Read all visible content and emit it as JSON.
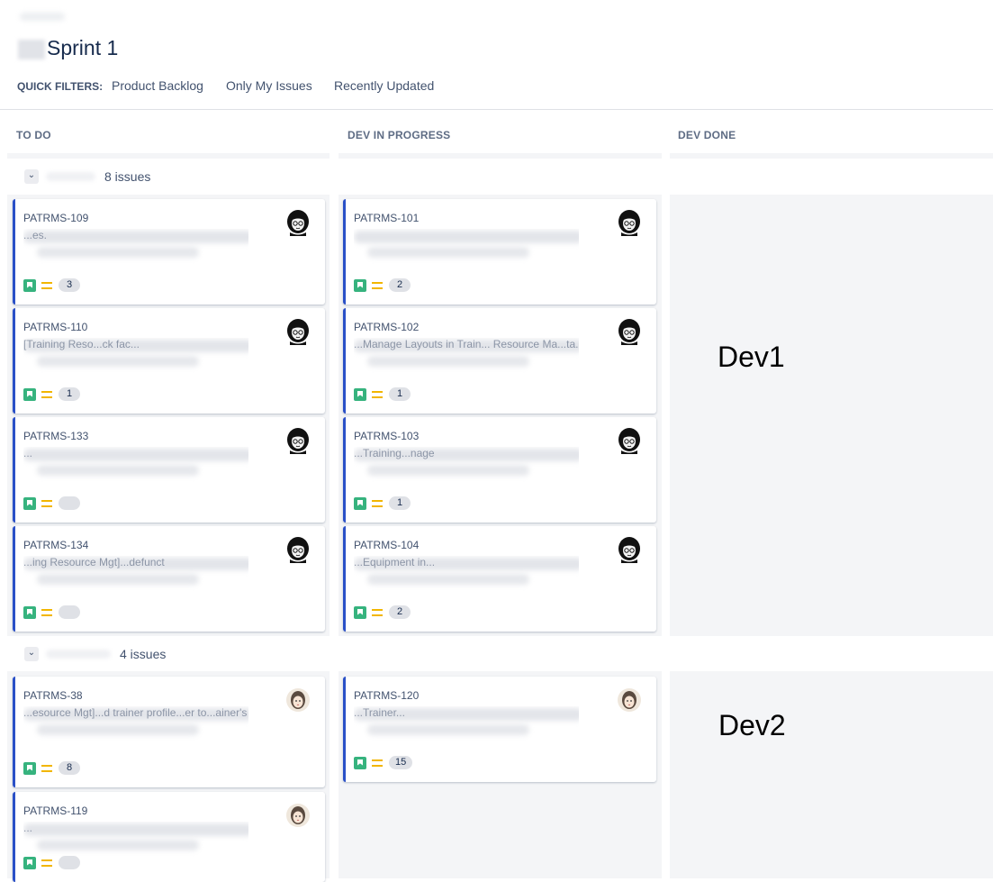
{
  "board": {
    "title": "Sprint 1"
  },
  "quick_filters": {
    "label": "QUICK FILTERS:",
    "items": [
      "Product Backlog",
      "Only My Issues",
      "Recently Updated"
    ]
  },
  "columns": [
    "TO DO",
    "DEV IN PROGRESS",
    "DEV DONE"
  ],
  "swimlanes": [
    {
      "count": "8 issues",
      "annotation": "Dev1"
    },
    {
      "count": "4 issues",
      "annotation": "Dev2"
    }
  ],
  "cards": [
    {
      "key": "PATRMS-109",
      "summary": "...es.",
      "estimate": "3",
      "avatar": "dark-avatar-icon"
    },
    {
      "key": "PATRMS-110",
      "summary": "[Training Reso...ck fac...",
      "estimate": "1",
      "avatar": "dark-avatar-icon"
    },
    {
      "key": "PATRMS-133",
      "summary": "...",
      "estimate": "",
      "avatar": "dark-avatar-icon"
    },
    {
      "key": "PATRMS-134",
      "summary": "...ing Resource Mgt]...defunct",
      "estimate": "",
      "avatar": "dark-avatar-icon"
    },
    {
      "key": "PATRMS-101",
      "summary": "",
      "estimate": "2",
      "avatar": "dark-avatar-icon"
    },
    {
      "key": "PATRMS-102",
      "summary": "...Manage Layouts in Train... Resource Ma...ta.",
      "estimate": "1",
      "avatar": "dark-avatar-icon"
    },
    {
      "key": "PATRMS-103",
      "summary": "...Training...nage",
      "estimate": "1",
      "avatar": "dark-avatar-icon"
    },
    {
      "key": "PATRMS-104",
      "summary": "...Equipment in...",
      "estimate": "2",
      "avatar": "dark-avatar-icon"
    },
    {
      "key": "PATRMS-38",
      "summary": "...esource Mgt]...d trainer profile...er to...ainer's",
      "estimate": "8",
      "avatar": "light-avatar-icon"
    },
    {
      "key": "PATRMS-119",
      "summary": "...",
      "estimate": "",
      "avatar": "light-avatar-icon"
    },
    {
      "key": "PATRMS-120",
      "summary": "...Trainer...",
      "estimate": "15",
      "avatar": "light-avatar-icon"
    }
  ],
  "colors": {
    "accent_border": "#2a50c7",
    "story": "#36b37e",
    "priority": "#f2b600"
  }
}
